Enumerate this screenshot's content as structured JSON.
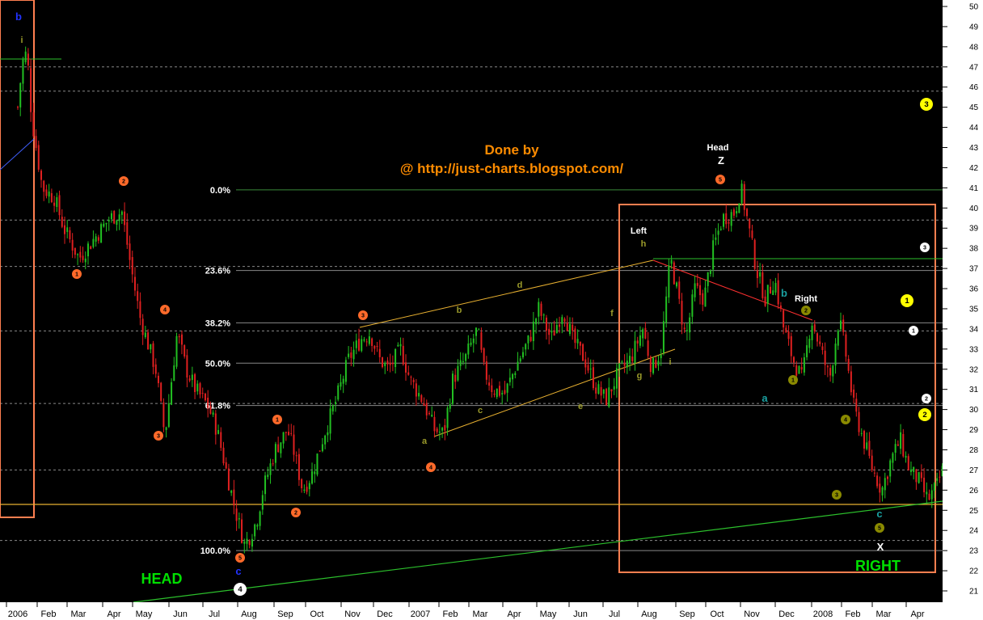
{
  "chart_data": {
    "type": "candlestick",
    "title": "Done by",
    "subtitle": "@ http://just-charts.blogspot.com/",
    "ylim": [
      20.5,
      50.5
    ],
    "y_ticks": [
      21,
      22,
      23,
      24,
      25,
      26,
      27,
      28,
      29,
      30,
      31,
      32,
      33,
      34,
      35,
      36,
      37,
      38,
      39,
      40,
      41,
      42,
      43,
      44,
      45,
      46,
      47,
      48,
      49,
      50
    ],
    "x_ticks": [
      "2006",
      "Feb",
      "Mar",
      "Apr",
      "May",
      "Jun",
      "Jul",
      "Aug",
      "Sep",
      "Oct",
      "Nov",
      "Dec",
      "2007",
      "Feb",
      "Mar",
      "Apr",
      "May",
      "Jun",
      "Jul",
      "Aug",
      "Sep",
      "Oct",
      "Nov",
      "Dec",
      "2008",
      "Feb",
      "Mar",
      "Apr"
    ],
    "price_path": [
      [
        0,
        45
      ],
      [
        0.15,
        47.2
      ],
      [
        0.3,
        47.8
      ],
      [
        0.45,
        44.5
      ],
      [
        0.8,
        41
      ],
      [
        1.2,
        40.5
      ],
      [
        1.5,
        39
      ],
      [
        2.0,
        37.5
      ],
      [
        2.5,
        38.5
      ],
      [
        3.0,
        39.5
      ],
      [
        3.4,
        39.8
      ],
      [
        3.7,
        37
      ],
      [
        4.0,
        34.5
      ],
      [
        4.5,
        32
      ],
      [
        4.8,
        28.7
      ],
      [
        5.2,
        33.8
      ],
      [
        5.5,
        32
      ],
      [
        5.8,
        31
      ],
      [
        6.2,
        30.2
      ],
      [
        6.5,
        29
      ],
      [
        6.8,
        27
      ],
      [
        7.1,
        25
      ],
      [
        7.4,
        23.3
      ],
      [
        7.6,
        23.8
      ],
      [
        7.8,
        24.5
      ],
      [
        8.0,
        26
      ],
      [
        8.4,
        28
      ],
      [
        8.8,
        29
      ],
      [
        9.0,
        28
      ],
      [
        9.3,
        26
      ],
      [
        9.6,
        26.8
      ],
      [
        10.0,
        28.8
      ],
      [
        10.4,
        30.5
      ],
      [
        10.8,
        32.5
      ],
      [
        11.2,
        33.5
      ],
      [
        11.5,
        33.8
      ],
      [
        11.8,
        32.5
      ],
      [
        12.1,
        32
      ],
      [
        12.5,
        33
      ],
      [
        12.8,
        31.5
      ],
      [
        13.2,
        30.5
      ],
      [
        13.6,
        29
      ],
      [
        13.9,
        28.8
      ],
      [
        14.2,
        31.5
      ],
      [
        14.6,
        32.5
      ],
      [
        15.0,
        34
      ],
      [
        15.2,
        32
      ],
      [
        15.5,
        31
      ],
      [
        15.9,
        30.8
      ],
      [
        16.3,
        32.3
      ],
      [
        16.7,
        33.5
      ],
      [
        17.0,
        35
      ],
      [
        17.4,
        33.5
      ],
      [
        17.8,
        35
      ],
      [
        18.1,
        33.5
      ],
      [
        18.5,
        32.5
      ],
      [
        18.9,
        31
      ],
      [
        19.2,
        30.5
      ],
      [
        19.6,
        31.8
      ],
      [
        20.0,
        32.5
      ],
      [
        20.4,
        34
      ],
      [
        20.7,
        32
      ],
      [
        21.0,
        33
      ],
      [
        21.3,
        37.5
      ],
      [
        21.5,
        36
      ],
      [
        21.8,
        33.5
      ],
      [
        22.1,
        36
      ],
      [
        22.4,
        35.5
      ],
      [
        22.7,
        38
      ],
      [
        23.0,
        39.5
      ],
      [
        23.4,
        39.8
      ],
      [
        23.6,
        41
      ],
      [
        23.8,
        39.5
      ],
      [
        24.1,
        37
      ],
      [
        24.4,
        35.5
      ],
      [
        24.7,
        36.5
      ],
      [
        25.0,
        34
      ],
      [
        25.3,
        32.5
      ],
      [
        25.6,
        31.5
      ],
      [
        25.9,
        34.5
      ],
      [
        26.2,
        33
      ],
      [
        26.5,
        31.5
      ],
      [
        26.8,
        34.5
      ],
      [
        27.0,
        33
      ],
      [
        27.3,
        30
      ],
      [
        27.6,
        28.5
      ],
      [
        27.9,
        27
      ],
      [
        28.2,
        26
      ],
      [
        28.5,
        27.5
      ],
      [
        28.8,
        28.5
      ],
      [
        29.1,
        27
      ],
      [
        29.4,
        26.5
      ],
      [
        29.7,
        25.5
      ],
      [
        30.0,
        26.2
      ],
      [
        30.3,
        27.5
      ],
      [
        30.6,
        30
      ],
      [
        30.9,
        32.5
      ],
      [
        31.2,
        33.6
      ],
      [
        31.5,
        32
      ],
      [
        31.7,
        31
      ]
    ],
    "fib_levels": [
      {
        "label": "0.0%",
        "price": 40.9
      },
      {
        "label": "23.6%",
        "price": 36.9
      },
      {
        "label": "38.2%",
        "price": 34.3
      },
      {
        "label": "50.0%",
        "price": 32.3
      },
      {
        "label": "61.8%",
        "price": 30.2
      },
      {
        "label": "100.0%",
        "price": 23.0
      }
    ],
    "annotations": {
      "title_color": "#ff8c00",
      "head_bottom": "HEAD",
      "right_bottom": "RIGHT",
      "left": "Left",
      "head": "Head",
      "right": "Right",
      "z": "Z",
      "x": "X",
      "b_top": "b",
      "i_top": "i",
      "c_bottom": "c",
      "a_teal": "a",
      "b_teal": "b",
      "c_teal": "c",
      "letters_olive": [
        "a",
        "b",
        "c",
        "d",
        "e",
        "f",
        "g",
        "h",
        "i"
      ],
      "wave_numbers": [
        "1",
        "2",
        "3",
        "4",
        "5"
      ]
    }
  }
}
